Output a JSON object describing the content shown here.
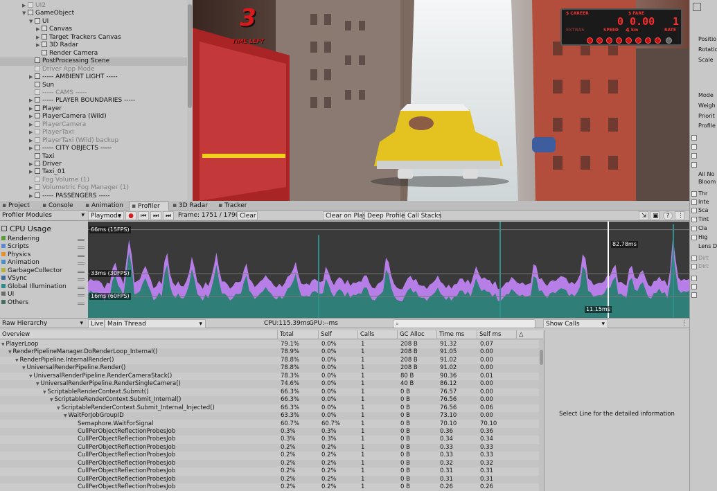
{
  "hierarchy": {
    "items": [
      {
        "label": "UI2",
        "depth": 1,
        "arrow": "right",
        "dim": true,
        "selected": false
      },
      {
        "label": "GameObject",
        "depth": 1,
        "arrow": "down",
        "dim": false,
        "selected": false
      },
      {
        "label": "UI",
        "depth": 2,
        "arrow": "down",
        "dim": false,
        "selected": false
      },
      {
        "label": "Canvas",
        "depth": 3,
        "arrow": "right",
        "dim": false,
        "selected": false
      },
      {
        "label": "Target Trackers Canvas",
        "depth": 3,
        "arrow": "right",
        "dim": false,
        "selected": false
      },
      {
        "label": "3D Radar",
        "depth": 3,
        "arrow": "right",
        "dim": false,
        "selected": false
      },
      {
        "label": "Render Camera",
        "depth": 3,
        "arrow": "",
        "dim": false,
        "selected": false
      },
      {
        "label": "PostProcessing Scene",
        "depth": 2,
        "arrow": "",
        "dim": false,
        "selected": true
      },
      {
        "label": "Driver App Mode",
        "depth": 2,
        "arrow": "",
        "dim": true,
        "selected": false
      },
      {
        "label": "----- AMBIENT LIGHT -----",
        "depth": 2,
        "arrow": "right",
        "dim": false,
        "selected": false
      },
      {
        "label": "Sun",
        "depth": 2,
        "arrow": "",
        "dim": false,
        "selected": false
      },
      {
        "label": "----- CAMS -----",
        "depth": 2,
        "arrow": "",
        "dim": true,
        "selected": false
      },
      {
        "label": "----- PLAYER BOUNDARIES -----",
        "depth": 2,
        "arrow": "right",
        "dim": false,
        "selected": false
      },
      {
        "label": "Player",
        "depth": 2,
        "arrow": "right",
        "dim": false,
        "selected": false
      },
      {
        "label": "PlayerCamera (Wild)",
        "depth": 2,
        "arrow": "right",
        "dim": false,
        "selected": false
      },
      {
        "label": "PlayerCamera",
        "depth": 2,
        "arrow": "right",
        "dim": true,
        "selected": false
      },
      {
        "label": "PlayerTaxi",
        "depth": 2,
        "arrow": "right",
        "dim": true,
        "selected": false
      },
      {
        "label": "PlayerTaxi (Wild) backup",
        "depth": 2,
        "arrow": "right",
        "dim": true,
        "selected": false
      },
      {
        "label": "----- CITY OBJECTS -----",
        "depth": 2,
        "arrow": "right",
        "dim": false,
        "selected": false
      },
      {
        "label": "Taxi",
        "depth": 2,
        "arrow": "",
        "dim": false,
        "selected": false
      },
      {
        "label": "Driver",
        "depth": 2,
        "arrow": "right",
        "dim": false,
        "selected": false
      },
      {
        "label": "Taxi_01",
        "depth": 2,
        "arrow": "right",
        "dim": false,
        "selected": false
      },
      {
        "label": "Fog Volume (1)",
        "depth": 2,
        "arrow": "",
        "dim": true,
        "selected": false
      },
      {
        "label": "Volumetric Fog Manager (1)",
        "depth": 2,
        "arrow": "right",
        "dim": true,
        "selected": false
      },
      {
        "label": "----- PASSENGERS -----",
        "depth": 2,
        "arrow": "right",
        "dim": false,
        "selected": false
      }
    ]
  },
  "game": {
    "time_value": "3",
    "time_label": "TIME LEFT",
    "meter": {
      "career_label": "$ CAREER",
      "fare_label": "$ FARE",
      "speed_label": "SPEED",
      "rate_label": "RATE",
      "km_label": "km",
      "fare_value": "0 0.00",
      "rate_value": "1",
      "speed_value": "4",
      "extras_label": "EXTRAS"
    }
  },
  "tabs": [
    {
      "label": "Project",
      "active": false
    },
    {
      "label": "Console",
      "active": false
    },
    {
      "label": "Animation",
      "active": false
    },
    {
      "label": "Profiler",
      "active": true
    },
    {
      "label": "3D Radar",
      "active": false
    },
    {
      "label": "Tracker",
      "active": false
    }
  ],
  "toolbar": {
    "modules_label": "Profiler Modules",
    "target": "Playmode",
    "frame": "Frame: 1751 / 1790",
    "clear": "Clear",
    "clear_on_play": "Clear on Play",
    "deep_profile": "Deep Profile",
    "call_stacks": "Call Stacks"
  },
  "modules": {
    "title": "CPU Usage",
    "title_icon": "cpu-icon",
    "items": [
      {
        "label": "Rendering",
        "color": "#5a9c2e"
      },
      {
        "label": "Scripts",
        "color": "#5e8ad1"
      },
      {
        "label": "Physics",
        "color": "#e38f2d"
      },
      {
        "label": "Animation",
        "color": "#4c8fc5"
      },
      {
        "label": "GarbageCollector",
        "color": "#b3b03c"
      },
      {
        "label": "VSync",
        "color": "#3f6a99"
      },
      {
        "label": "Global Illumination",
        "color": "#2f8a8a"
      },
      {
        "label": "UI",
        "color": "#6d6d6d"
      },
      {
        "label": "Others",
        "color": "#4a6e5e"
      }
    ]
  },
  "chart_data": {
    "type": "area",
    "y_unit": "ms",
    "reference_lines": [
      {
        "label": "66ms (15FPS)",
        "value": 66
      },
      {
        "label": "33ms (30FPS)",
        "value": 33
      },
      {
        "label": "16ms (60FPS)",
        "value": 16
      }
    ],
    "selected_frame_labels": {
      "top": "82.78ms",
      "bottom": "11.15ms"
    },
    "series": [
      {
        "name": "Scripts",
        "color": "#b87ee8"
      },
      {
        "name": "Others",
        "color": "#2f7f78"
      }
    ]
  },
  "lowerbar": {
    "view": "Raw Hierarchy",
    "live": "Live",
    "thread": "Main Thread",
    "cpu": "CPU:115.39ms",
    "gpu": "GPU:--ms",
    "search_placeholder": "",
    "show_calls": "Show Calls"
  },
  "table": {
    "columns": [
      "Overview",
      "Total",
      "Self",
      "Calls",
      "GC Alloc",
      "Time ms",
      "Self ms"
    ],
    "rows": [
      {
        "name": "PlayerLoop",
        "depth": 0,
        "arrow": "down",
        "total": "79.1%",
        "self": "0.0%",
        "calls": "1",
        "gc": "208 B",
        "time": "91.32",
        "selfms": "0.07"
      },
      {
        "name": "RenderPipelineManager.DoRenderLoop_Internal()",
        "depth": 1,
        "arrow": "down",
        "total": "78.9%",
        "self": "0.0%",
        "calls": "1",
        "gc": "208 B",
        "time": "91.05",
        "selfms": "0.00"
      },
      {
        "name": "RenderPipeline.InternalRender()",
        "depth": 2,
        "arrow": "down",
        "total": "78.8%",
        "self": "0.0%",
        "calls": "1",
        "gc": "208 B",
        "time": "91.02",
        "selfms": "0.00"
      },
      {
        "name": "UniversalRenderPipeline.Render()",
        "depth": 3,
        "arrow": "down",
        "total": "78.8%",
        "self": "0.0%",
        "calls": "1",
        "gc": "208 B",
        "time": "91.02",
        "selfms": "0.00"
      },
      {
        "name": "UniversalRenderPipeline.RenderCameraStack()",
        "depth": 4,
        "arrow": "down",
        "total": "78.3%",
        "self": "0.0%",
        "calls": "1",
        "gc": "80 B",
        "time": "90.36",
        "selfms": "0.01"
      },
      {
        "name": "UniversalRenderPipeline.RenderSingleCamera()",
        "depth": 5,
        "arrow": "down",
        "total": "74.6%",
        "self": "0.0%",
        "calls": "1",
        "gc": "40 B",
        "time": "86.12",
        "selfms": "0.00"
      },
      {
        "name": "ScriptableRenderContext.Submit()",
        "depth": 6,
        "arrow": "down",
        "total": "66.3%",
        "self": "0.0%",
        "calls": "1",
        "gc": "0 B",
        "time": "76.57",
        "selfms": "0.00"
      },
      {
        "name": "ScriptableRenderContext.Submit_Internal()",
        "depth": 7,
        "arrow": "down",
        "total": "66.3%",
        "self": "0.0%",
        "calls": "1",
        "gc": "0 B",
        "time": "76.56",
        "selfms": "0.00"
      },
      {
        "name": "ScriptableRenderContext.Submit_Internal_Injected()",
        "depth": 8,
        "arrow": "down",
        "total": "66.3%",
        "self": "0.0%",
        "calls": "1",
        "gc": "0 B",
        "time": "76.56",
        "selfms": "0.06"
      },
      {
        "name": "WaitForJobGroupID",
        "depth": 9,
        "arrow": "down",
        "total": "63.3%",
        "self": "0.0%",
        "calls": "1",
        "gc": "0 B",
        "time": "73.10",
        "selfms": "0.00"
      },
      {
        "name": "Semaphore.WaitForSignal",
        "depth": 10,
        "arrow": "",
        "total": "60.7%",
        "self": "60.7%",
        "calls": "1",
        "gc": "0 B",
        "time": "70.10",
        "selfms": "70.10"
      },
      {
        "name": "CullPerObjectReflectionProbesJob",
        "depth": 10,
        "arrow": "",
        "total": "0.3%",
        "self": "0.3%",
        "calls": "1",
        "gc": "0 B",
        "time": "0.36",
        "selfms": "0.36"
      },
      {
        "name": "CullPerObjectReflectionProbesJob",
        "depth": 10,
        "arrow": "",
        "total": "0.3%",
        "self": "0.3%",
        "calls": "1",
        "gc": "0 B",
        "time": "0.34",
        "selfms": "0.34"
      },
      {
        "name": "CullPerObjectReflectionProbesJob",
        "depth": 10,
        "arrow": "",
        "total": "0.2%",
        "self": "0.2%",
        "calls": "1",
        "gc": "0 B",
        "time": "0.33",
        "selfms": "0.33"
      },
      {
        "name": "CullPerObjectReflectionProbesJob",
        "depth": 10,
        "arrow": "",
        "total": "0.2%",
        "self": "0.2%",
        "calls": "1",
        "gc": "0 B",
        "time": "0.33",
        "selfms": "0.33"
      },
      {
        "name": "CullPerObjectReflectionProbesJob",
        "depth": 10,
        "arrow": "",
        "total": "0.2%",
        "self": "0.2%",
        "calls": "1",
        "gc": "0 B",
        "time": "0.32",
        "selfms": "0.32"
      },
      {
        "name": "CullPerObjectReflectionProbesJob",
        "depth": 10,
        "arrow": "",
        "total": "0.2%",
        "self": "0.2%",
        "calls": "1",
        "gc": "0 B",
        "time": "0.31",
        "selfms": "0.31"
      },
      {
        "name": "CullPerObjectReflectionProbesJob",
        "depth": 10,
        "arrow": "",
        "total": "0.2%",
        "self": "0.2%",
        "calls": "1",
        "gc": "0 B",
        "time": "0.31",
        "selfms": "0.31"
      },
      {
        "name": "CullPerObjectReflectionProbesJob",
        "depth": 10,
        "arrow": "",
        "total": "0.2%",
        "self": "0.2%",
        "calls": "1",
        "gc": "0 B",
        "time": "0.26",
        "selfms": "0.26"
      }
    ]
  },
  "detail": {
    "message": "Select Line for the detailed information"
  },
  "inspector": {
    "rows": [
      "Positio",
      "Rotatio",
      "Scale",
      "Mode",
      "Weigh",
      "Priorit",
      "Profile",
      "All  No",
      "Bloom",
      "Thr",
      "Inte",
      "Sca",
      "Tint",
      "Cla",
      "Hig",
      "Lens Di",
      "Dirt",
      "Dirt"
    ]
  }
}
